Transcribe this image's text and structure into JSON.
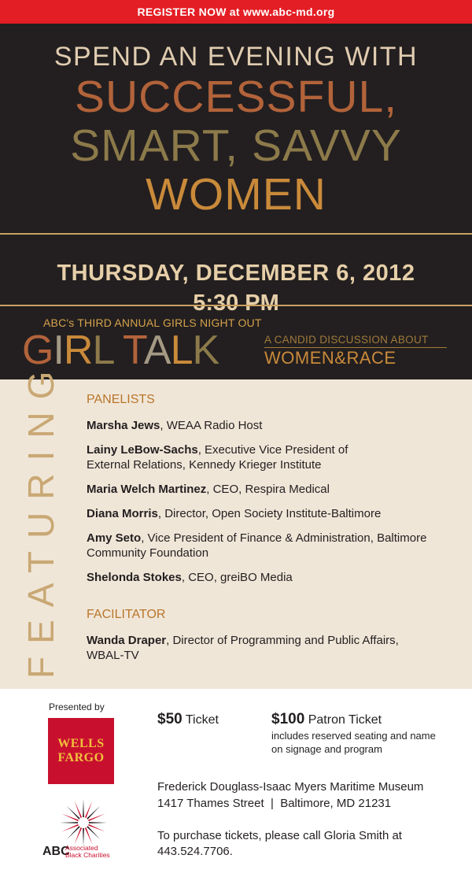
{
  "register": {
    "prefix": "REGISTER NOW",
    "text": "at www.abc-md.org"
  },
  "headline": {
    "line1": "SPEND AN EVENING WITH",
    "line2": "SUCCESSFUL,",
    "line3": "SMART, SAVVY",
    "line4": "WOMEN"
  },
  "event": {
    "date": "THURSDAY, DECEMBER 6, 2012",
    "time": "5:30 PM"
  },
  "program": {
    "series": "ABC's THIRD ANNUAL GIRLS NIGHT OUT",
    "title_parts": [
      "G",
      "I",
      "R",
      "L",
      " T",
      "A",
      "L",
      "K"
    ],
    "subtitle_top": "A CANDID DISCUSSION ABOUT",
    "subtitle_bottom": "WOMEN&RACE"
  },
  "featuring": {
    "vertical_word": "FEATURING",
    "panelists_heading": "PANELISTS",
    "panelists": [
      {
        "name": "Marsha Jews",
        "role": ", WEAA Radio Host"
      },
      {
        "name": "Lainy LeBow-Sachs",
        "role": ", Executive Vice President of External Relations, Kennedy Krieger Institute"
      },
      {
        "name": "Maria Welch Martinez",
        "role": ", CEO, Respira Medical"
      },
      {
        "name": "Diana Morris",
        "role": ", Director, Open Society Institute-Baltimore"
      },
      {
        "name": "Amy Seto",
        "role": ", Vice President of Finance & Administration, Baltimore Community Foundation"
      },
      {
        "name": "Shelonda Stokes",
        "role": ", CEO, greiBO Media"
      }
    ],
    "facilitator_heading": "FACILITATOR",
    "facilitator": {
      "name": "Wanda Draper",
      "role": ", Director of Programming and Public Affairs, WBAL-TV"
    }
  },
  "sponsors": {
    "presented_by": "Presented by",
    "wells_line1": "WELLS",
    "wells_line2": "FARGO",
    "abc_short": "ABC",
    "abc_line1": "Associated",
    "abc_line2": "Black Charities"
  },
  "tickets": {
    "standard_price": "$50",
    "standard_label": " Ticket",
    "patron_price": "$100",
    "patron_label": " Patron Ticket",
    "patron_note": "includes reserved seating and name on signage and program"
  },
  "venue": {
    "name": "Frederick Douglass-Isaac Myers Maritime Museum",
    "address": "1417 Thames Street  |  Baltimore, MD 21231"
  },
  "purchase": "To purchase tickets, please call Gloria Smith at 443.524.7706.",
  "colors": {
    "red": "#e31e24",
    "dark": "#231f20",
    "copper": "#b2633a",
    "olive": "#8c7a4a",
    "gold": "#c98a3a",
    "cream": "#f0e6d8",
    "wells_red": "#c8102e",
    "wells_gold": "#f2c03c"
  }
}
